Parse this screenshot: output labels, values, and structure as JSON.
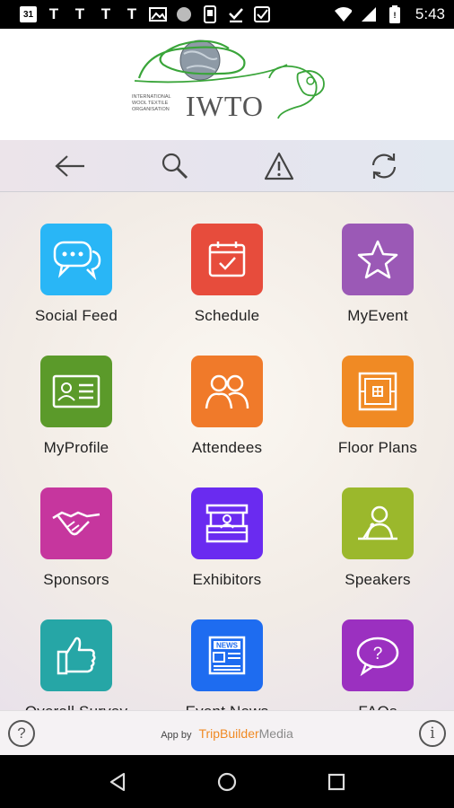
{
  "status_bar": {
    "calendar_day": "31",
    "notifications": [
      "T",
      "T",
      "T",
      "T"
    ],
    "time": "5:43"
  },
  "logo": {
    "name": "IWTO",
    "subtitle_lines": [
      "INTERNATIONAL",
      "WOOL TEXTILE",
      "ORGANISATION"
    ]
  },
  "toolbar": {
    "buttons": [
      "back-arrow-icon",
      "search-icon",
      "alert-icon",
      "refresh-icon"
    ]
  },
  "tiles": [
    {
      "label": "Social Feed",
      "color": "#29b6f6",
      "icon": "chat-bubbles-icon"
    },
    {
      "label": "Schedule",
      "color": "#e74c3c",
      "icon": "calendar-check-icon"
    },
    {
      "label": "MyEvent",
      "color": "#9b59b6",
      "icon": "star-icon"
    },
    {
      "label": "MyProfile",
      "color": "#5b9a2a",
      "icon": "id-card-icon"
    },
    {
      "label": "Attendees",
      "color": "#f07a2a",
      "icon": "people-icon"
    },
    {
      "label": "Floor Plans",
      "color": "#f08a24",
      "icon": "floor-plan-icon"
    },
    {
      "label": "Sponsors",
      "color": "#c6369e",
      "icon": "handshake-icon"
    },
    {
      "label": "Exhibitors",
      "color": "#6a2bf0",
      "icon": "booth-icon"
    },
    {
      "label": "Speakers",
      "color": "#9bb82c",
      "icon": "speaker-podium-icon"
    },
    {
      "label": "Overall Survey",
      "color": "#26a6a6",
      "icon": "thumbs-up-icon"
    },
    {
      "label": "Event News",
      "color": "#1e6cf0",
      "icon": "newspaper-icon"
    },
    {
      "label": "FAQs",
      "color": "#9b30c0",
      "icon": "question-bubble-icon"
    }
  ],
  "footer": {
    "app_by": "App by",
    "brand_main": "TripBuilder",
    "brand_suffix": "Media",
    "help_symbol": "?",
    "info_symbol": "i"
  }
}
